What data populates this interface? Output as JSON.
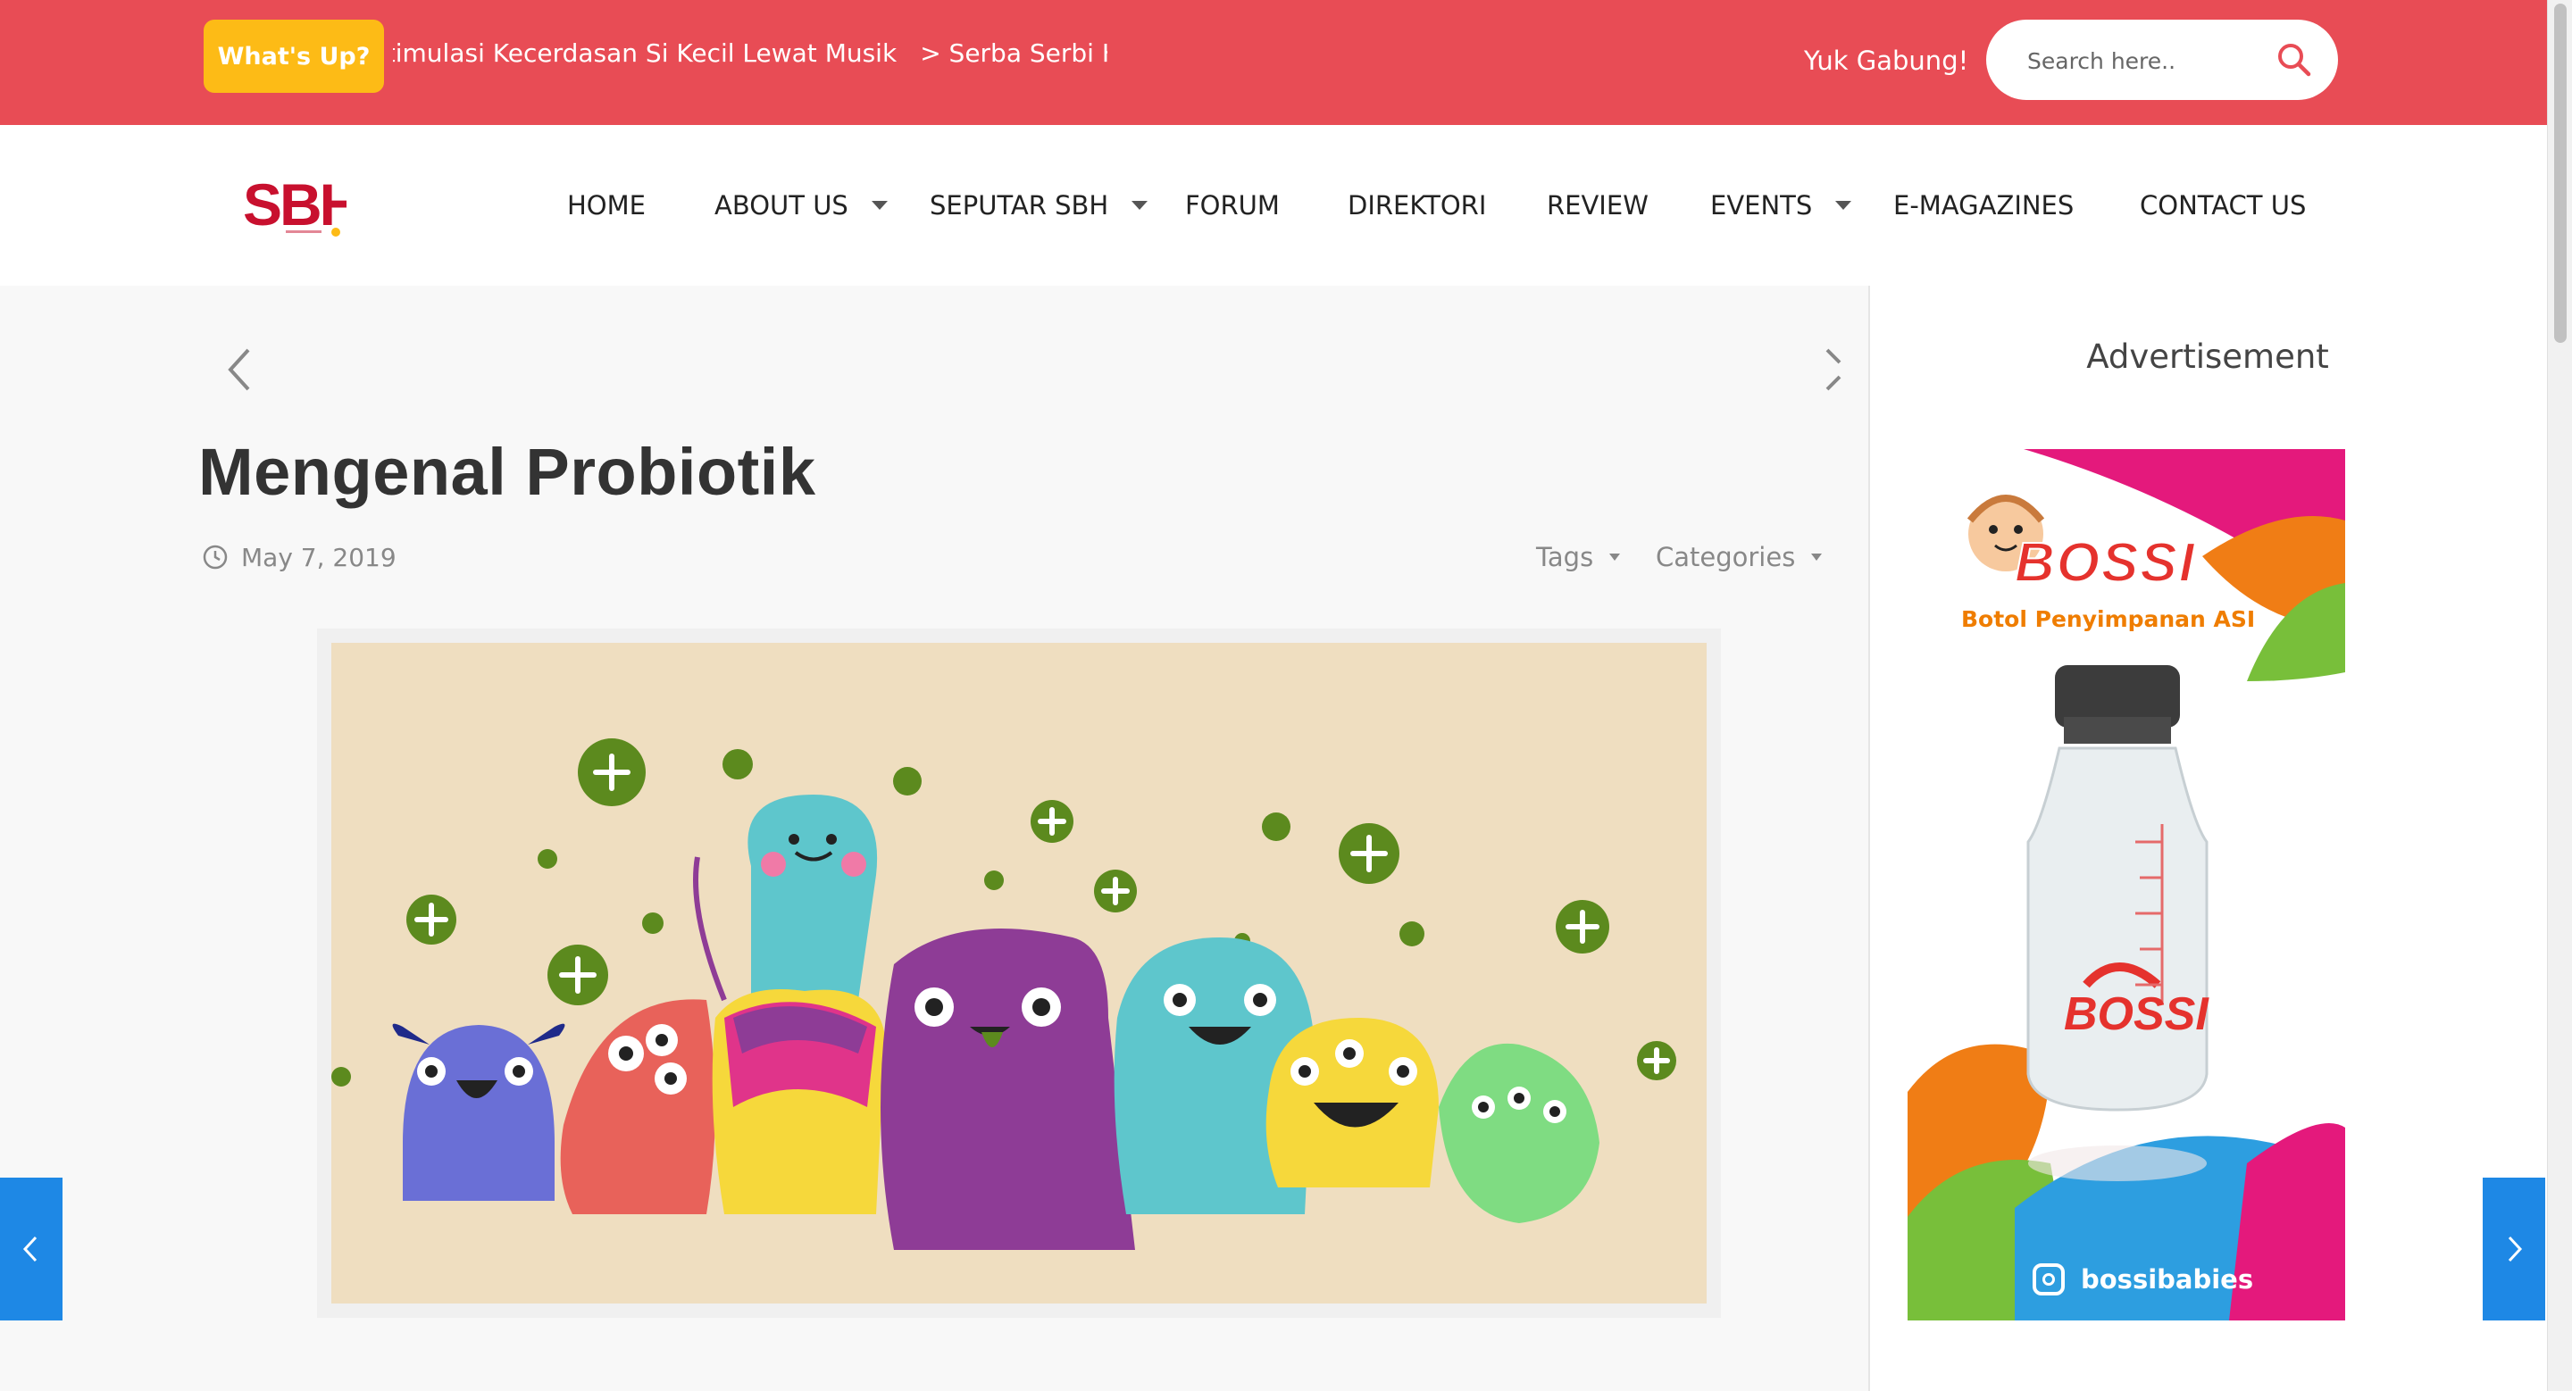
{
  "topbar": {
    "whats_up": "What's Up?",
    "ticker": [
      "Stimulasi Kecerdasan Si Kecil Lewat Musik",
      "> Serba Serbi Kehamilan"
    ],
    "join": "Yuk Gabung!",
    "search_placeholder": "Search here.."
  },
  "logo": {
    "text": "SBH"
  },
  "nav": {
    "items": [
      {
        "label": "HOME",
        "dropdown": false
      },
      {
        "label": "ABOUT US",
        "dropdown": true
      },
      {
        "label": "SEPUTAR SBH",
        "dropdown": true
      },
      {
        "label": "FORUM",
        "dropdown": false
      },
      {
        "label": "DIREKTORI",
        "dropdown": false
      },
      {
        "label": "REVIEW",
        "dropdown": false
      },
      {
        "label": "EVENTS",
        "dropdown": true
      },
      {
        "label": "E-MAGAZINES",
        "dropdown": false
      },
      {
        "label": "CONTACT US",
        "dropdown": false
      }
    ]
  },
  "post": {
    "title": "Mengenal Probiotik",
    "date": "May 7, 2019",
    "tags_label": "Tags",
    "categories_label": "Categories"
  },
  "sidebar": {
    "ad_title": "Advertisement",
    "ad_brand": "BOSSI",
    "ad_subtitle": "Botol Penyimpanan ASI",
    "ad_instagram": "bossibabies"
  },
  "colors": {
    "topbar": "#e84c55",
    "badge": "#fdbb16",
    "edge_button": "#1e88e5"
  }
}
